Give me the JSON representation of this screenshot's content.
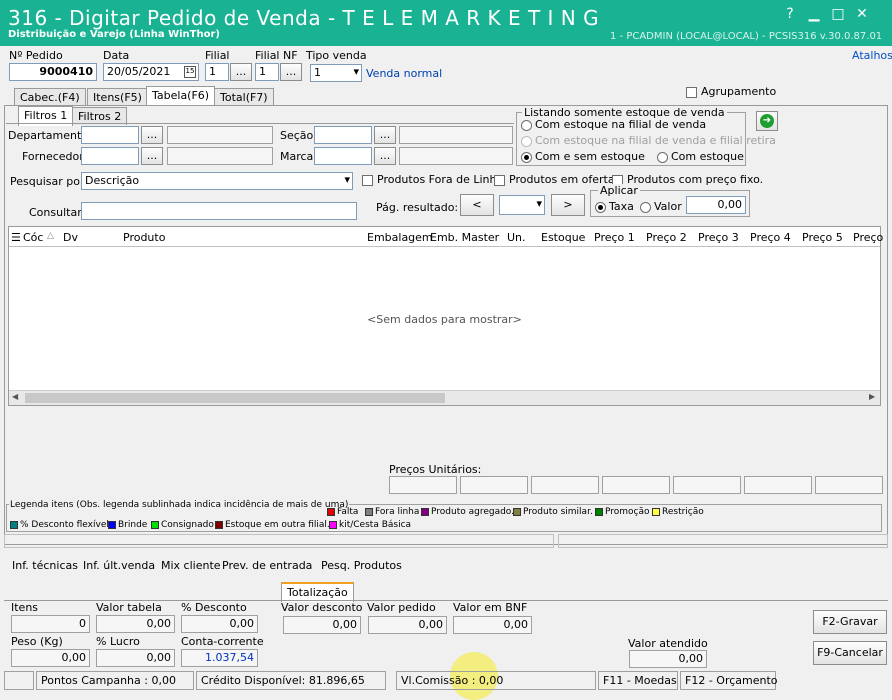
{
  "window": {
    "title": "316 - Digitar Pedido de Venda - T E L E M A R K E T I N G",
    "subtitle": "Distribuição e Varejo (Linha WinThor)",
    "status": "1 - PCADMIN (LOCAL@LOCAL) - PCSIS316  v.30.0.87.01",
    "help": "?",
    "min": "▁",
    "max": "□",
    "close": "✕",
    "atalhos": "Atalhos"
  },
  "header": {
    "pedido_label": "Nº Pedido",
    "pedido_value": "9000410",
    "data_label": "Data",
    "data_value": "20/05/2021",
    "filial_label": "Filial",
    "filial_value": "1",
    "filialnf_label": "Filial NF",
    "filialnf_value": "1",
    "tipovenda_label": "Tipo venda",
    "tipovenda_value": "1",
    "tipovenda_desc": "Venda normal",
    "ellipsis": "...",
    "agrupamento": "Agrupamento"
  },
  "tabs": [
    "Cabec.(F4)",
    "Itens(F5)",
    "Tabela(F6)",
    "Total(F7)"
  ],
  "subtabs": [
    "Filtros 1",
    "Filtros 2"
  ],
  "filters": {
    "departamento": "Departamento",
    "fornecedor": "Fornecedor",
    "secao": "Seção",
    "marca": "Marca",
    "pesquisar_por": "Pesquisar por",
    "pesquisar_value": "Descrição",
    "consultar": "Consultar",
    "prod_fora_linha": "Produtos Fora de Linha",
    "prod_oferta": "Produtos em oferta.",
    "prod_preco_fixo": "Produtos com preço fixo.",
    "pag_resultado": "Pág. resultado:",
    "prev": "<",
    "next": ">"
  },
  "estoque": {
    "title": "Listando somente estoque de venda",
    "opt1": "Com estoque na filial de venda",
    "opt2": "Com estoque na filial de venda e filial retira",
    "opt3": "Com e sem estoque",
    "opt4": "Com estoque"
  },
  "aplicar": {
    "title": "Aplicar",
    "taxa": "Taxa",
    "valor": "Valor",
    "value": "0,00"
  },
  "grid": {
    "columns": [
      "Cóc",
      "Dv",
      "Produto",
      "Embalagem",
      "Emb. Master",
      "Un.",
      "Estoque",
      "Preço 1",
      "Preço 2",
      "Preço 3",
      "Preço 4",
      "Preço 5",
      "Preço"
    ],
    "empty": "<Sem dados para mostrar>"
  },
  "precos_unitarios": "Preços Unitários:",
  "legend": {
    "title": "Legenda itens (Obs. legenda sublinhada indica incidência de mais de uma)",
    "items": [
      {
        "label": "Falta",
        "color": "#e00000"
      },
      {
        "label": "Fora linha",
        "color": "#808080"
      },
      {
        "label": "Produto agregado.",
        "color": "#800080"
      },
      {
        "label": "Produto similar.",
        "color": "#808040"
      },
      {
        "label": "Promoção",
        "color": "#008000"
      },
      {
        "label": "Restrição",
        "color": "#ffff40"
      },
      {
        "label": "% Desconto flexível",
        "color": "#008080"
      },
      {
        "label": "Brinde",
        "color": "#0000ff"
      },
      {
        "label": "Consignado",
        "color": "#00e000"
      },
      {
        "label": "Estoque em outra filial.",
        "color": "#800000"
      },
      {
        "label": "kit/Cesta Básica",
        "color": "#ff00ff"
      }
    ]
  },
  "bottom_links": [
    "Inf. técnicas",
    "Inf. últ.venda",
    "Mix cliente",
    "Prev. de entrada",
    "Pesq. Produtos"
  ],
  "totalizacao": {
    "tab": "Totalização",
    "itens_label": "Itens",
    "itens": "0",
    "valor_tabela_label": "Valor tabela",
    "valor_tabela": "0,00",
    "desconto_label": "% Desconto",
    "desconto": "0,00",
    "peso_label": "Peso (Kg)",
    "peso": "0,00",
    "lucro_label": "% Lucro",
    "lucro": "0,00",
    "cc_label": "Conta-corrente",
    "cc": "1.037,54",
    "valor_desconto_label": "Valor desconto",
    "valor_desconto": "0,00",
    "valor_pedido_label": "Valor pedido",
    "valor_pedido": "0,00",
    "valor_bnf_label": "Valor em BNF",
    "valor_bnf": "0,00",
    "valor_atendido_label": "Valor atendido",
    "valor_atendido": "0,00",
    "gravar": "F2-Gravar",
    "cancelar": "F9-Cancelar"
  },
  "statusbar": {
    "pontos": "Pontos Campanha : 0,00",
    "credito": "Crédito Disponível: 81.896,65",
    "comissao": "Vl.Comissão : 0,00",
    "moedas": "F11 - Moedas",
    "orcamento": "F12 - Orçamento"
  }
}
